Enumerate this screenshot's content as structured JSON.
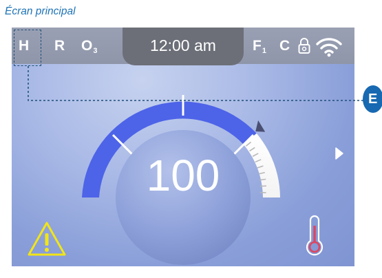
{
  "caption": "Écran principal",
  "status_bar": {
    "left_indicators": [
      "H",
      "R",
      "O"
    ],
    "o3_subscript": "3",
    "time": "12:00 am",
    "filter_label": "F",
    "filter_subscript": "1",
    "unit_label": "C"
  },
  "gauge": {
    "value": "100",
    "level_fraction": 0.78
  },
  "callout_marker": "E",
  "colors": {
    "gauge_active": "#4d63e8",
    "warning": "#f2e516",
    "thermometer": "#e0455e",
    "callout": "#1769b1"
  },
  "icons": {
    "lock": "lock-icon",
    "wifi": "wifi-icon",
    "next": "chevron-right-icon",
    "warning": "warning-icon",
    "thermometer": "thermometer-icon"
  }
}
